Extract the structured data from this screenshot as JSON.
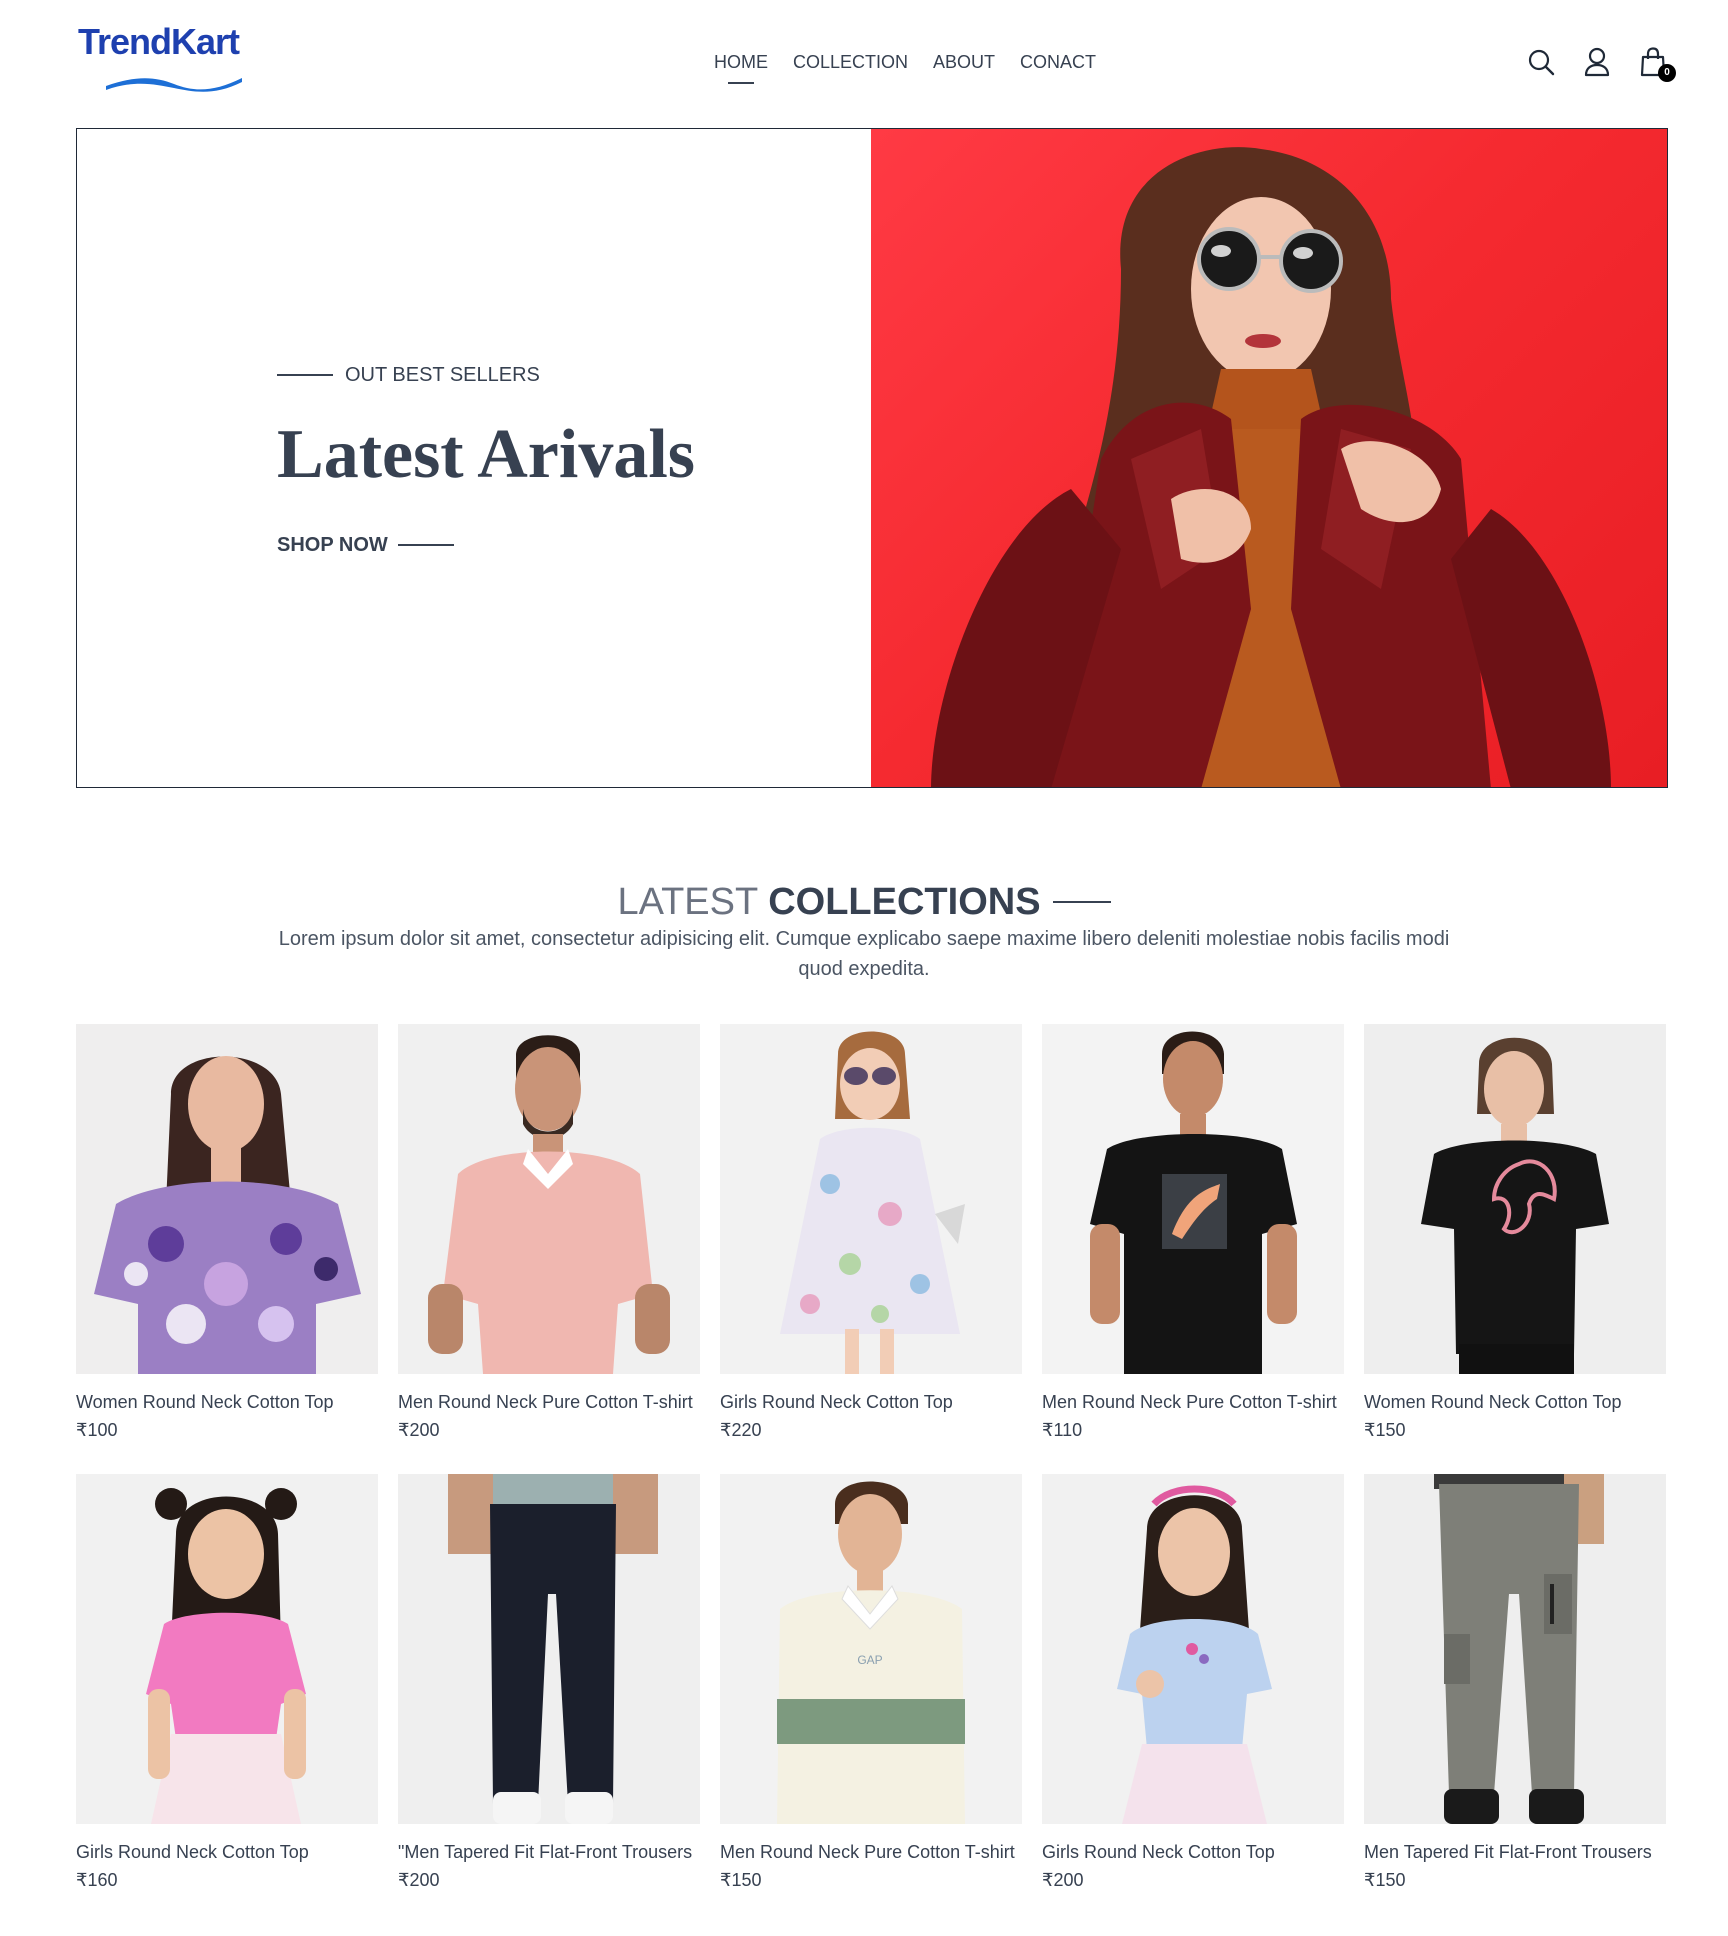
{
  "brand": {
    "name": "TrendKart",
    "primary_color": "#1e40af",
    "accent_color": "#1d6fd6"
  },
  "nav": {
    "links": [
      {
        "label": "HOME",
        "active": true
      },
      {
        "label": "COLLECTION",
        "active": false
      },
      {
        "label": "ABOUT",
        "active": false
      },
      {
        "label": "CONACT",
        "active": false
      }
    ],
    "icons": [
      "search-icon",
      "user-icon",
      "shopping-bag-icon"
    ],
    "cart_count": "0"
  },
  "hero": {
    "eyebrow": "OUT BEST SELLERS",
    "title": "Latest Arivals",
    "cta": "SHOP NOW",
    "image_background": "#ff3a44"
  },
  "collections": {
    "title_light": "LATEST",
    "title_bold": "COLLECTIONS",
    "description": "Lorem ipsum dolor sit amet, consectetur adipisicing elit. Cumque explicabo saepe maxime libero deleniti molestiae nobis facilis modi quod expedita.",
    "products": [
      {
        "name": "Women Round Neck Cotton Top",
        "price": "₹100"
      },
      {
        "name": "Men Round Neck Pure Cotton T-shirt",
        "price": "₹200"
      },
      {
        "name": "Girls Round Neck Cotton Top",
        "price": "₹220"
      },
      {
        "name": "Men Round Neck Pure Cotton T-shirt",
        "price": "₹110"
      },
      {
        "name": "Women Round Neck Cotton Top",
        "price": "₹150"
      },
      {
        "name": "Girls Round Neck Cotton Top",
        "price": "₹160"
      },
      {
        "name": "\"Men Tapered Fit Flat-Front Trousers",
        "price": "₹200"
      },
      {
        "name": "Men Round Neck Pure Cotton T-shirt",
        "price": "₹150"
      },
      {
        "name": "Girls Round Neck Cotton Top",
        "price": "₹200"
      },
      {
        "name": "Men Tapered Fit Flat-Front Trousers",
        "price": "₹150"
      }
    ]
  }
}
